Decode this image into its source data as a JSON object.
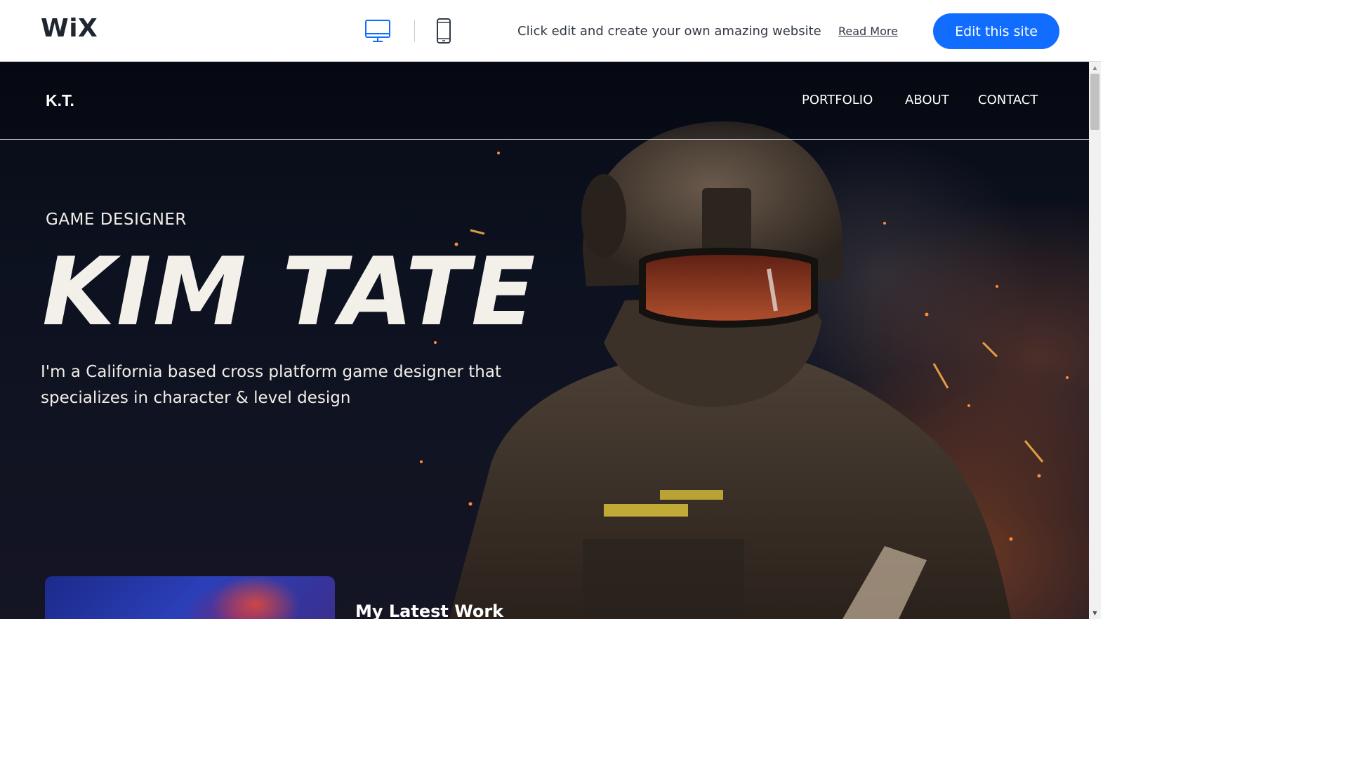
{
  "wix_bar": {
    "logo": "WiX",
    "device_icons": [
      "desktop-icon",
      "mobile-icon"
    ],
    "message": "Click edit and create your own amazing website",
    "read_more": "Read More",
    "edit_button": "Edit this site",
    "accent_color": "#116dff"
  },
  "site": {
    "logo": "K.T.",
    "nav": [
      "PORTFOLIO",
      "ABOUT",
      "CONTACT"
    ],
    "hero": {
      "eyebrow": "GAME DESIGNER",
      "title": "KIM TATE",
      "description": "I'm a California based cross platform game designer that specializes in character & level design"
    },
    "latest_work": {
      "heading": "My Latest Work"
    }
  },
  "scrollbar": {
    "up_icon": "scroll-up-arrow-icon",
    "down_icon": "scroll-down-arrow-icon"
  }
}
